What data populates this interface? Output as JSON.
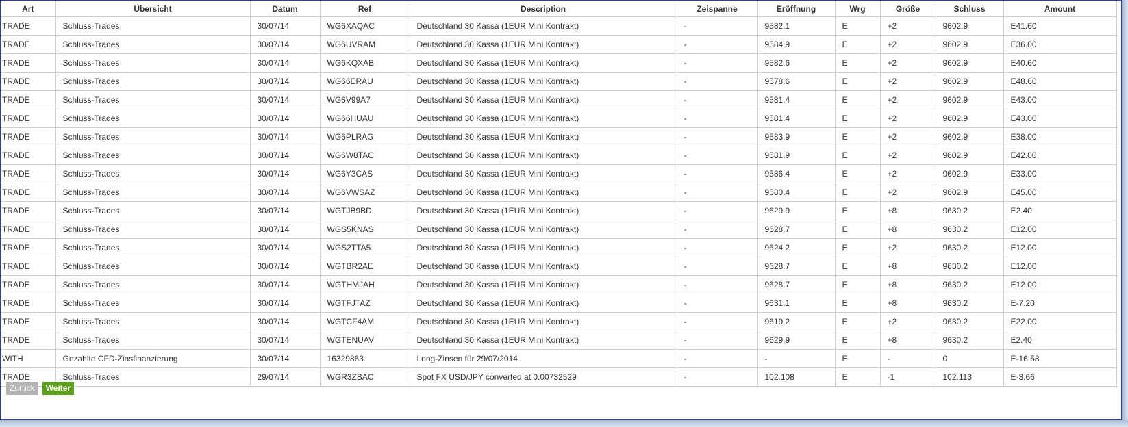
{
  "table": {
    "headers": [
      "Art",
      "Übersicht",
      "Datum",
      "Ref",
      "Description",
      "Zeispanne",
      "Eröffnung",
      "Wrg",
      "Größe",
      "Schluss",
      "Amount"
    ],
    "rows": [
      [
        "TRADE",
        "Schluss-Trades",
        "30/07/14",
        "WG6XAQAC",
        "Deutschland 30 Kassa (1EUR Mini Kontrakt)",
        "-",
        "9582.1",
        "E",
        "+2",
        "9602.9",
        "E41.60"
      ],
      [
        "TRADE",
        "Schluss-Trades",
        "30/07/14",
        "WG6UVRAM",
        "Deutschland 30 Kassa (1EUR Mini Kontrakt)",
        "-",
        "9584.9",
        "E",
        "+2",
        "9602.9",
        "E36.00"
      ],
      [
        "TRADE",
        "Schluss-Trades",
        "30/07/14",
        "WG6KQXAB",
        "Deutschland 30 Kassa (1EUR Mini Kontrakt)",
        "-",
        "9582.6",
        "E",
        "+2",
        "9602.9",
        "E40.60"
      ],
      [
        "TRADE",
        "Schluss-Trades",
        "30/07/14",
        "WG66ERAU",
        "Deutschland 30 Kassa (1EUR Mini Kontrakt)",
        "-",
        "9578.6",
        "E",
        "+2",
        "9602.9",
        "E48.60"
      ],
      [
        "TRADE",
        "Schluss-Trades",
        "30/07/14",
        "WG6V99A7",
        "Deutschland 30 Kassa (1EUR Mini Kontrakt)",
        "-",
        "9581.4",
        "E",
        "+2",
        "9602.9",
        "E43.00"
      ],
      [
        "TRADE",
        "Schluss-Trades",
        "30/07/14",
        "WG66HUAU",
        "Deutschland 30 Kassa (1EUR Mini Kontrakt)",
        "-",
        "9581.4",
        "E",
        "+2",
        "9602.9",
        "E43.00"
      ],
      [
        "TRADE",
        "Schluss-Trades",
        "30/07/14",
        "WG6PLRAG",
        "Deutschland 30 Kassa (1EUR Mini Kontrakt)",
        "-",
        "9583.9",
        "E",
        "+2",
        "9602.9",
        "E38.00"
      ],
      [
        "TRADE",
        "Schluss-Trades",
        "30/07/14",
        "WG6W8TAC",
        "Deutschland 30 Kassa (1EUR Mini Kontrakt)",
        "-",
        "9581.9",
        "E",
        "+2",
        "9602.9",
        "E42.00"
      ],
      [
        "TRADE",
        "Schluss-Trades",
        "30/07/14",
        "WG6Y3CAS",
        "Deutschland 30 Kassa (1EUR Mini Kontrakt)",
        "-",
        "9586.4",
        "E",
        "+2",
        "9602.9",
        "E33.00"
      ],
      [
        "TRADE",
        "Schluss-Trades",
        "30/07/14",
        "WG6VWSAZ",
        "Deutschland 30 Kassa (1EUR Mini Kontrakt)",
        "-",
        "9580.4",
        "E",
        "+2",
        "9602.9",
        "E45.00"
      ],
      [
        "TRADE",
        "Schluss-Trades",
        "30/07/14",
        "WGTJB9BD",
        "Deutschland 30 Kassa (1EUR Mini Kontrakt)",
        "-",
        "9629.9",
        "E",
        "+8",
        "9630.2",
        "E2.40"
      ],
      [
        "TRADE",
        "Schluss-Trades",
        "30/07/14",
        "WGS5KNAS",
        "Deutschland 30 Kassa (1EUR Mini Kontrakt)",
        "-",
        "9628.7",
        "E",
        "+8",
        "9630.2",
        "E12.00"
      ],
      [
        "TRADE",
        "Schluss-Trades",
        "30/07/14",
        "WGS2TTA5",
        "Deutschland 30 Kassa (1EUR Mini Kontrakt)",
        "-",
        "9624.2",
        "E",
        "+2",
        "9630.2",
        "E12.00"
      ],
      [
        "TRADE",
        "Schluss-Trades",
        "30/07/14",
        "WGTBR2AE",
        "Deutschland 30 Kassa (1EUR Mini Kontrakt)",
        "-",
        "9628.7",
        "E",
        "+8",
        "9630.2",
        "E12.00"
      ],
      [
        "TRADE",
        "Schluss-Trades",
        "30/07/14",
        "WGTHMJAH",
        "Deutschland 30 Kassa (1EUR Mini Kontrakt)",
        "-",
        "9628.7",
        "E",
        "+8",
        "9630.2",
        "E12.00"
      ],
      [
        "TRADE",
        "Schluss-Trades",
        "30/07/14",
        "WGTFJTAZ",
        "Deutschland 30 Kassa (1EUR Mini Kontrakt)",
        "-",
        "9631.1",
        "E",
        "+8",
        "9630.2",
        "E-7.20"
      ],
      [
        "TRADE",
        "Schluss-Trades",
        "30/07/14",
        "WGTCF4AM",
        "Deutschland 30 Kassa (1EUR Mini Kontrakt)",
        "-",
        "9619.2",
        "E",
        "+2",
        "9630.2",
        "E22.00"
      ],
      [
        "TRADE",
        "Schluss-Trades",
        "30/07/14",
        "WGTENUAV",
        "Deutschland 30 Kassa (1EUR Mini Kontrakt)",
        "-",
        "9629.9",
        "E",
        "+8",
        "9630.2",
        "E2.40"
      ],
      [
        "WITH",
        "Gezahlte CFD-Zinsfinanzierung",
        "30/07/14",
        "16329863",
        "Long-Zinsen für 29/07/2014",
        "-",
        "-",
        "E",
        "-",
        "0",
        "E-16.58"
      ],
      [
        "TRADE",
        "Schluss-Trades",
        "29/07/14",
        "WGR3ZBAC",
        "Spot FX USD/JPY converted at 0.00732529",
        "-",
        "102.108",
        "E",
        "-1",
        "102.113",
        "E-3.66"
      ]
    ]
  },
  "pagination": {
    "back_label": "Zurück",
    "next_label": "Weiter"
  },
  "colors": {
    "back_button": "#b4b4b4",
    "next_button": "#5da11b",
    "window_border": "#2b3fa8"
  }
}
